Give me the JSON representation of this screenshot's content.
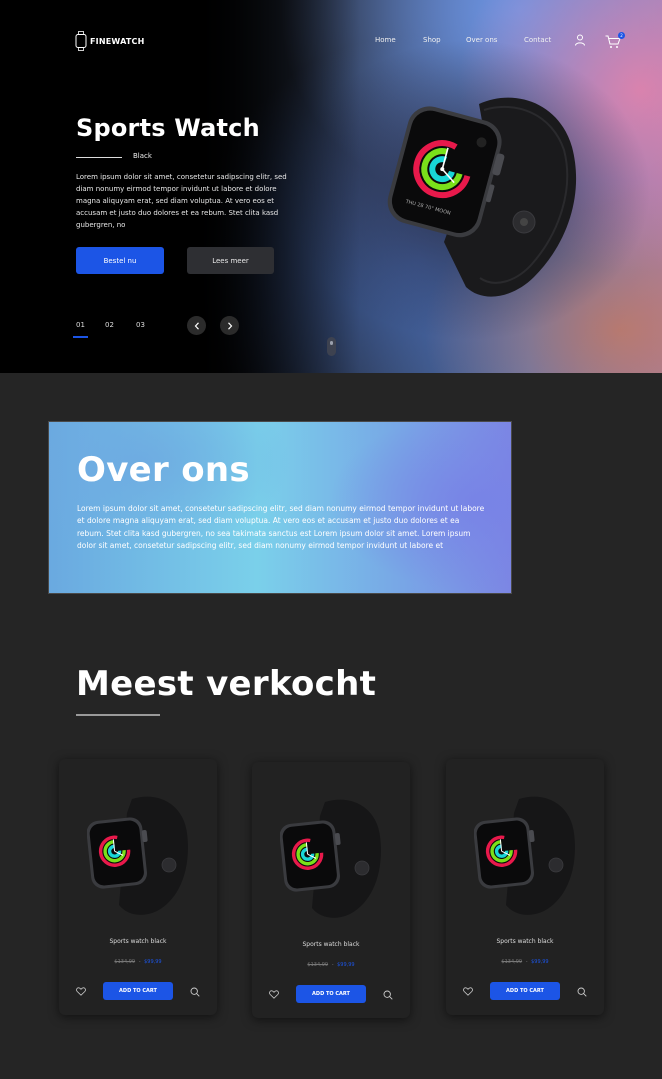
{
  "header": {
    "logo_text": "FINEWATCH",
    "nav": [
      "Home",
      "Shop",
      "Over ons",
      "Contact"
    ],
    "cart_count": "2"
  },
  "hero": {
    "title": "Sports Watch",
    "color_label": "Black",
    "description": "Lorem ipsum dolor sit amet, consetetur sadipscing elitr, sed diam nonumy eirmod tempor invidunt ut labore et dolore magna aliquyam erat, sed diam voluptua. At vero eos et accusam et justo duo dolores et ea rebum. Stet clita kasd gubergren, no",
    "primary_button": "Bestel nu",
    "secondary_button": "Lees meer",
    "slides": [
      "01",
      "02",
      "03"
    ],
    "active_slide": 1
  },
  "about": {
    "title": "Over ons",
    "text": "Lorem ipsum dolor sit amet, consetetur sadipscing elitr, sed diam nonumy eirmod tempor invidunt ut labore et dolore magna aliquyam erat, sed diam voluptua. At vero eos et accusam et justo duo dolores et ea rebum. Stet clita kasd gubergren, no sea takimata sanctus est Lorem ipsum dolor sit amet. Lorem ipsum dolor sit amet, consetetur sadipscing elitr, sed diam nonumy eirmod tempor invidunt ut labore et"
  },
  "bestsellers": {
    "title": "Meest verkocht",
    "products": [
      {
        "name": "Sports watch black",
        "old_price": "$134,99",
        "separator": "-",
        "new_price": "$99,99",
        "cart_label": "ADD TO CART"
      },
      {
        "name": "Sports watch black",
        "old_price": "$134,99",
        "separator": "-",
        "new_price": "$99,99",
        "cart_label": "ADD TO CART"
      },
      {
        "name": "Sports watch black",
        "old_price": "$134,99",
        "separator": "-",
        "new_price": "$99,99",
        "cart_label": "ADD TO CART"
      }
    ]
  },
  "colors": {
    "accent": "#1c55e6",
    "background": "#252525",
    "card": "#222222"
  },
  "icons": [
    "watch-logo-icon",
    "user-icon",
    "cart-icon",
    "chevron-left-icon",
    "chevron-right-icon",
    "heart-icon",
    "search-icon"
  ]
}
